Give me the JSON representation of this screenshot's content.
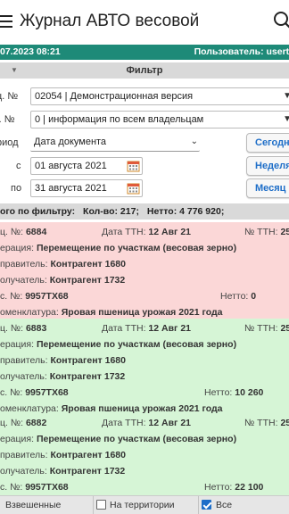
{
  "app": {
    "title": "Журнал АВТО весовой"
  },
  "status": {
    "datetime": "07.2023 08:21",
    "user_label": "Пользователь: userte"
  },
  "filter": {
    "header": "Фильтр",
    "rows": [
      {
        "label": "ц. №",
        "value": "02054 | Демонстрационная версия"
      },
      {
        "label": "г. №",
        "value": "0 | информация по всем владельцам"
      },
      {
        "label": "риод",
        "value": "Дата документа"
      }
    ],
    "from_label": "с",
    "from_date": "01 августа 2021",
    "to_label": "по",
    "to_date": "31 августа 2021",
    "quick_buttons": [
      "Сегодня",
      "Неделя",
      "Месяц"
    ]
  },
  "summary": {
    "label": "ого по фильтру:",
    "count": "Кол-во: 217;",
    "netto": "Нетто: 4 776 920;"
  },
  "cards": [
    {
      "color": "#fbd7d7",
      "doc_no_label": "ц. №:",
      "doc_no": "6884",
      "ttn_date_label": "Дата ТТН:",
      "ttn_date": "12 Авг 21",
      "ttn_no_label": "№ ТТН:",
      "ttn_no": "25",
      "operation_label": "ерация:",
      "operation": "Перемещение по участкам (весовая зерно)",
      "sender_label": "правитель:",
      "sender": "Контрагент 1680",
      "receiver_label": "олучатель:",
      "receiver": "Контрагент 1732",
      "car_label": "с. №:",
      "car": "9957ТХ68",
      "netto_label": "Нетто:",
      "netto": "0",
      "nomenclature_label": "оменклатура:",
      "nomenclature": "Яровая пшеница урожая 2021 года"
    },
    {
      "color": "#d6f5d6",
      "doc_no_label": "ц. №:",
      "doc_no": "6883",
      "ttn_date_label": "Дата ТТН:",
      "ttn_date": "12 Авг 21",
      "ttn_no_label": "№ ТТН:",
      "ttn_no": "25",
      "operation_label": "ерация:",
      "operation": "Перемещение по участкам (весовая зерно)",
      "sender_label": "правитель:",
      "sender": "Контрагент 1680",
      "receiver_label": "олучатель:",
      "receiver": "Контрагент 1732",
      "car_label": "с. №:",
      "car": "9957ТХ68",
      "netto_label": "Нетто:",
      "netto": "10 260",
      "nomenclature_label": "оменклатура:",
      "nomenclature": "Яровая пшеница урожая 2021 года"
    },
    {
      "color": "#d6f5d6",
      "doc_no_label": "ц. №:",
      "doc_no": "6882",
      "ttn_date_label": "Дата ТТН:",
      "ttn_date": "12 Авг 21",
      "ttn_no_label": "№ ТТН:",
      "ttn_no": "25",
      "operation_label": "ерация:",
      "operation": "Перемещение по участкам (весовая зерно)",
      "sender_label": "правитель:",
      "sender": "Контрагент 1680",
      "receiver_label": "олучатель:",
      "receiver": "Контрагент 1732",
      "car_label": "с. №:",
      "car": "9957ТХ68",
      "netto_label": "Нетто:",
      "netto": "22 100",
      "nomenclature_label": "оменклатура:",
      "nomenclature": "Яровая пшеница урожая 2021 года"
    }
  ],
  "bottom": {
    "tab_weighed": "Взвешенные",
    "tab_territory": "На территории",
    "tab_territory_checked": false,
    "tab_all": "Все",
    "tab_all_checked": true
  },
  "colors": {
    "accent": "#1e8a78",
    "link": "#1e6ec8",
    "pink_card": "#fbd7d7",
    "green_card": "#d6f5d6",
    "section_gray": "#d9d9d9"
  }
}
